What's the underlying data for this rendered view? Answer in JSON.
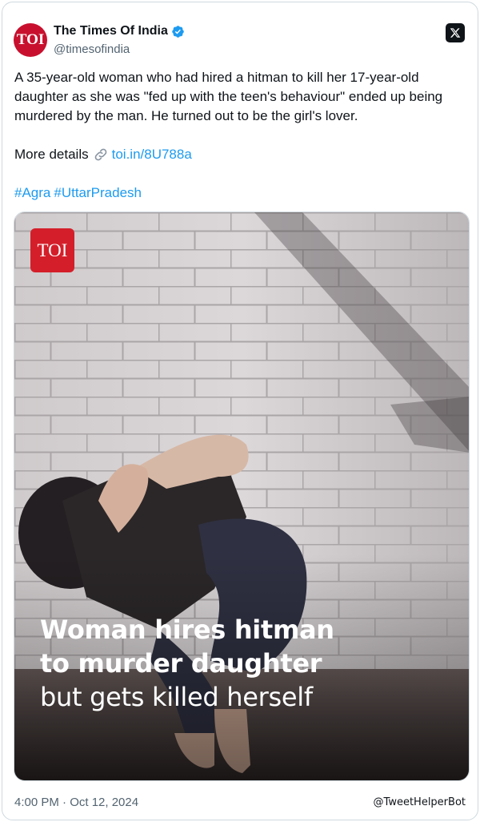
{
  "author": {
    "display_name": "The Times Of India",
    "handle": "@timesofindia",
    "avatar_text": "TOI",
    "verified": true
  },
  "tweet": {
    "text": "A 35-year-old woman who had hired a hitman to kill her 17-year-old daughter as she was \"fed up with the teen's behaviour\" ended up being murdered by the man. He turned out to be the girl's lover.",
    "details_label": "More details",
    "link_text": "toi.in/8U788a",
    "hashtags": [
      "#Agra",
      "#UttarPradesh"
    ]
  },
  "media": {
    "badge_text": "TOI",
    "headline_bold_1": "Woman hires hitman",
    "headline_bold_2": "to murder daughter",
    "headline_regular": "but gets killed herself"
  },
  "footer": {
    "timestamp": "4:00 PM · Oct 12, 2024",
    "credit": "@TweetHelperBot"
  },
  "colors": {
    "link": "#1d9bf0",
    "brand_red": "#d41f2a",
    "text": "#0f1419",
    "muted": "#536471"
  },
  "icons": [
    "verified-badge-icon",
    "x-logo-icon",
    "link-icon"
  ]
}
